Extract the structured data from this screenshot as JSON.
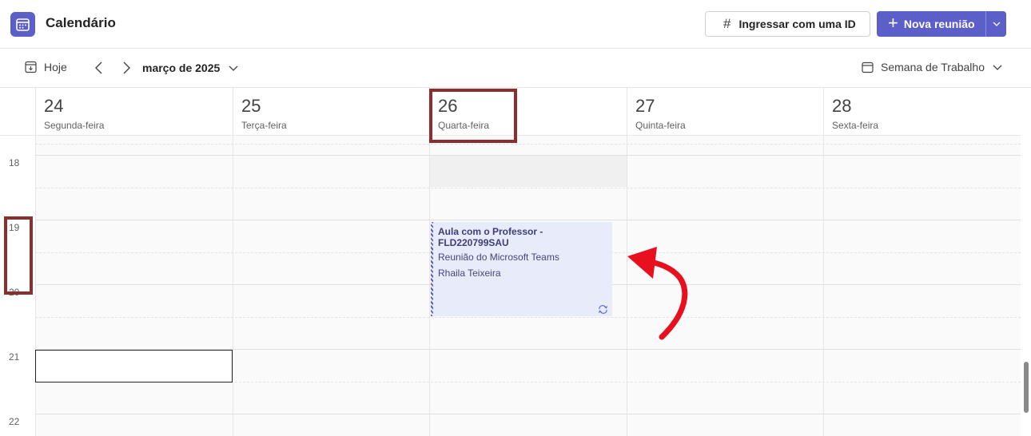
{
  "app": {
    "title": "Calendário",
    "icon": "calendar-icon",
    "accent_color": "#5b5fc7"
  },
  "header": {
    "join_button_label": "Ingressar com uma ID",
    "join_icon": "hash-icon",
    "new_meeting_label": "Nova reunião",
    "new_meeting_icon": "plus-icon"
  },
  "toolbar": {
    "today_label": "Hoje",
    "month_label": "março de 2025",
    "view_label": "Semana de Trabalho"
  },
  "days": [
    {
      "number": "24",
      "name": "Segunda-feira"
    },
    {
      "number": "25",
      "name": "Terça-feira"
    },
    {
      "number": "26",
      "name": "Quarta-feira"
    },
    {
      "number": "27",
      "name": "Quinta-feira"
    },
    {
      "number": "28",
      "name": "Sexta-feira"
    }
  ],
  "hours": [
    "18",
    "19",
    "20",
    "21",
    "22"
  ],
  "event": {
    "title": "Aula com o Professor - FLD220799SAU",
    "subtitle": "Reunião do Microsoft Teams",
    "organizer": "Rhaila Teixeira",
    "icon": "recurring-icon",
    "day": "26",
    "start_hour": "19",
    "end_hour": "20:30",
    "color": "#e8ebfa"
  },
  "annotations": {
    "box_color": "#8b2e2e",
    "arrow_color": "#e8101e"
  }
}
